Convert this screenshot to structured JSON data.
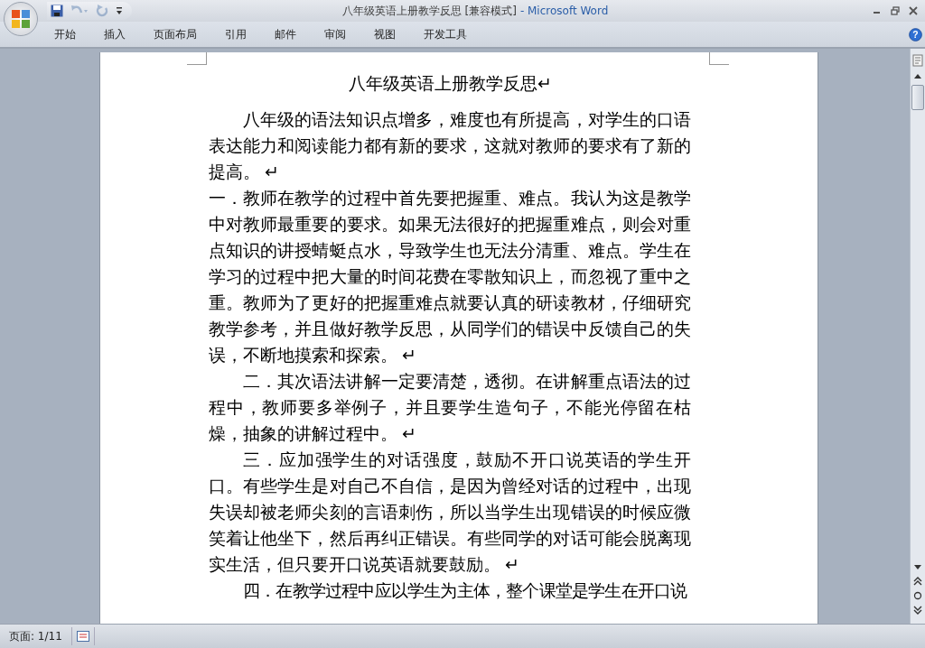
{
  "window": {
    "title": "八年级英语上册教学反思 [兼容模式]",
    "app": "- Microsoft Word"
  },
  "quick_access": [
    {
      "kind": "save",
      "disabled": false
    },
    {
      "kind": "undo",
      "disabled": true
    },
    {
      "kind": "redo",
      "disabled": true
    }
  ],
  "ribbon_tabs": [
    {
      "label": "开始",
      "selected": false
    },
    {
      "label": "插入",
      "selected": false
    },
    {
      "label": "页面布局",
      "selected": false
    },
    {
      "label": "引用",
      "selected": false
    },
    {
      "label": "邮件",
      "selected": false
    },
    {
      "label": "审阅",
      "selected": false
    },
    {
      "label": "视图",
      "selected": false
    },
    {
      "label": "开发工具",
      "selected": false
    }
  ],
  "help": "?",
  "document": {
    "title": "八年级英语上册教学反思↵",
    "paragraphs": [
      {
        "text": "八年级的语法知识点增多，难度也有所提高，对学生的口语表达能力和阅读能力都有新的要求，这就对教师的要求有了新的提高。 ↵",
        "indent": true
      },
      {
        "text": "一．教师在教学的过程中首先要把握重、难点。我认为这是教学中对教师最重要的要求。如果无法很好的把握重难点，则会对重点知识的讲授蜻蜓点水，导致学生也无法分清重、难点。学生在学习的过程中把大量的时间花费在零散知识上，而忽视了重中之重。教师为了更好的把握重难点就要认真的研读教材，仔细研究教学参考，并且做好教学反思，从同学们的错误中反馈自己的失误，不断地摸索和探索。 ↵",
        "indent": false
      },
      {
        "text": "二．其次语法讲解一定要清楚，透彻。在讲解重点语法的过程中，教师要多举例子，并且要学生造句子，不能光停留在枯燥，抽象的讲解过程中。 ↵",
        "indent": true
      },
      {
        "text": "三．应加强学生的对话强度，鼓励不开口说英语的学生开口。有些学生是对自己不自信，是因为曾经对话的过程中，出现失误却被老师尖刻的言语刺伤，所以当学生出现错误的时候应微笑着让他坐下，然后再纠正错误。有些同学的对话可能会脱离现实生活，但只要开口说英语就要鼓励。 ↵",
        "indent": true
      },
      {
        "text": "四．在教学过程中应以学生为主体，整个课堂是学生在开口说",
        "indent": true
      }
    ]
  },
  "status_bar": {
    "page": "页面: 1/11"
  }
}
